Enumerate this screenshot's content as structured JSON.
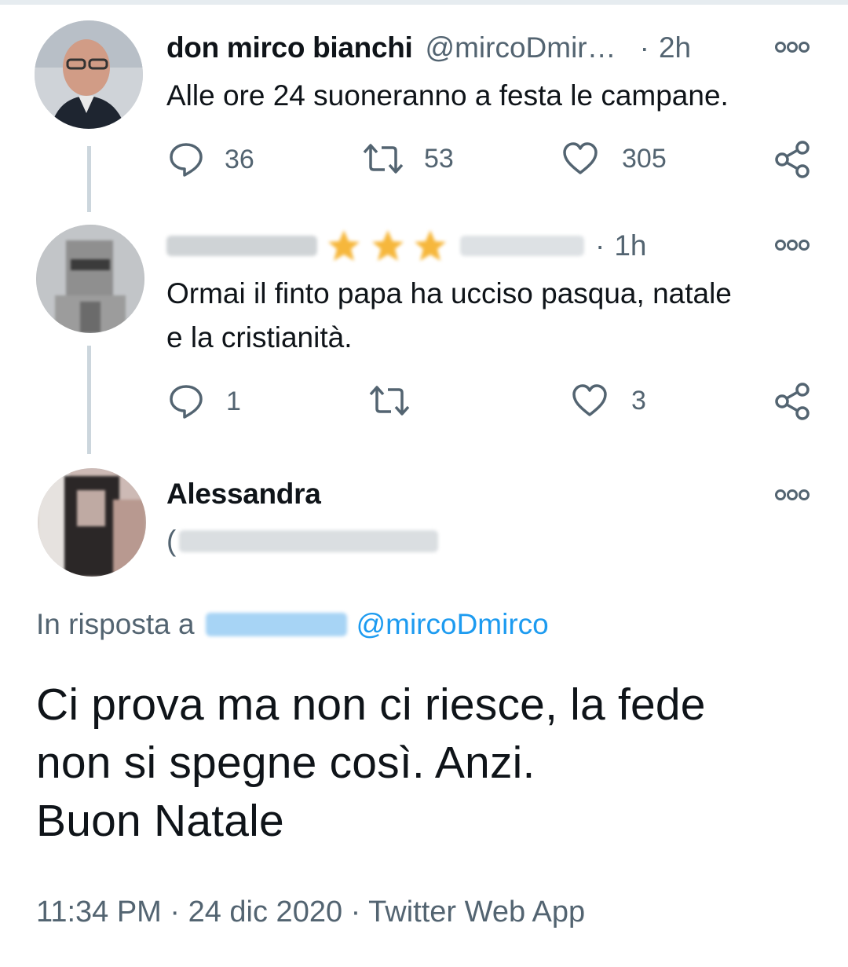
{
  "tweet1": {
    "author_name": "don mirco bianchi",
    "handle": "@mircoDmir…",
    "separator": "·",
    "time": "2h",
    "text": "Alle ore 24 suoneranno a festa le campane.",
    "replies": "36",
    "retweets": "53",
    "likes": "305"
  },
  "tweet2": {
    "separator": "·",
    "time": "1h",
    "text": "Ormai il finto papa ha ucciso pasqua, natale\ne la cristianità.",
    "replies": "1",
    "retweets": "",
    "likes": "3"
  },
  "tweet3": {
    "author_name": "Alessandra",
    "handle_prefix": "(",
    "reply_prefix": "In risposta a",
    "reply_mention_2": "@mircoDmirco",
    "text": "Ci prova ma non ci riesce, la fede\nnon si spegne così. Anzi.\nBuon Natale",
    "timestamp": "11:34 PM · 24 dic 2020 · Twitter Web App"
  },
  "colors": {
    "accent": "#1d9bf0",
    "secondary_text": "#536471",
    "thread_line": "#ccd6dd"
  }
}
